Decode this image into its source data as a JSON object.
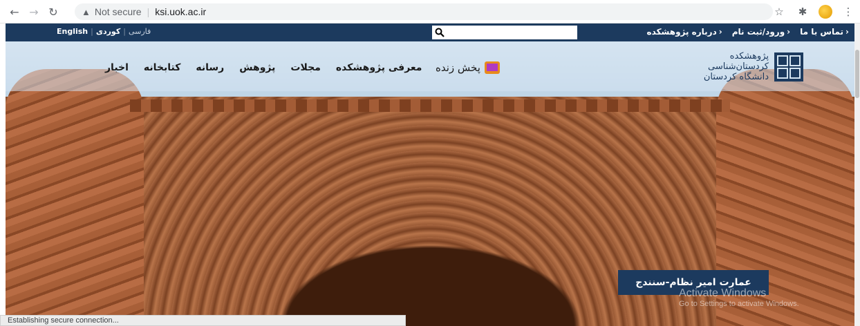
{
  "browser": {
    "security_label": "Not secure",
    "url": "ksi.uok.ac.ir",
    "status_text": "Establishing secure connection..."
  },
  "topbar": {
    "lang_active": "English",
    "lang_kurdi": "کوردی",
    "lang_farsi": "فارسی",
    "links": [
      "تماس با ما",
      "ورود/ثبت نام",
      "درباره پژوهشکده"
    ]
  },
  "header": {
    "logo_lines": [
      "پژوهشکده",
      "کردستان‌شناسی",
      "دانشگاه کردستان"
    ],
    "live_label": "پخش زنده",
    "menu": [
      "معرفی پژوهشکده",
      "مجلات",
      "پژوهش",
      "رسانه",
      "کتابخانه",
      "اخبار"
    ]
  },
  "hero": {
    "caption": "عمارت امیر نظام-سنندج"
  },
  "watermark": {
    "title": "Activate Windows",
    "subtitle": "Go to Settings to activate Windows."
  },
  "colors": {
    "brand_navy": "#1c3a5e"
  }
}
